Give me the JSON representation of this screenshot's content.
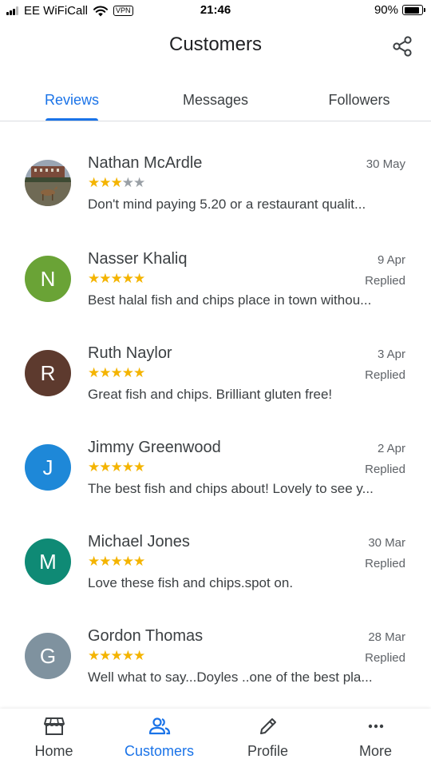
{
  "status_bar": {
    "carrier": "EE WiFiCall",
    "vpn": "VPN",
    "time": "21:46",
    "battery": "90%",
    "battery_level": 0.9
  },
  "header": {
    "title": "Customers",
    "share_icon": "share-icon"
  },
  "tabs": [
    {
      "label": "Reviews",
      "active": true
    },
    {
      "label": "Messages",
      "active": false
    },
    {
      "label": "Followers",
      "active": false
    }
  ],
  "reviews": [
    {
      "name": "Nathan McArdle",
      "date": "30 May",
      "rating": 3,
      "status": "",
      "text": "Don't mind paying 5.20 or a restaurant qualit...",
      "avatar_letter": "",
      "avatar_color": "#6b5a4a",
      "avatar_is_photo": true
    },
    {
      "name": "Nasser Khaliq",
      "date": "9 Apr",
      "rating": 5,
      "status": "Replied",
      "text": "Best halal fish and chips place in town withou...",
      "avatar_letter": "N",
      "avatar_color": "#6aa336"
    },
    {
      "name": "Ruth Naylor",
      "date": "3 Apr",
      "rating": 5,
      "status": "Replied",
      "text": "Great fish and chips. Brilliant gluten free!",
      "avatar_letter": "R",
      "avatar_color": "#5d3a2e"
    },
    {
      "name": "Jimmy Greenwood",
      "date": "2 Apr",
      "rating": 5,
      "status": "Replied",
      "text": "The best fish and chips about! Lovely to see y...",
      "avatar_letter": "J",
      "avatar_color": "#1e88d8"
    },
    {
      "name": "Michael Jones",
      "date": "30 Mar",
      "rating": 5,
      "status": "Replied",
      "text": "Love these fish and chips.spot on.",
      "avatar_letter": "M",
      "avatar_color": "#0f8a75"
    },
    {
      "name": "Gordon Thomas",
      "date": "28 Mar",
      "rating": 5,
      "status": "Replied",
      "text": "Well what to say...Doyles ..one of the best pla...",
      "avatar_letter": "G",
      "avatar_color": "#7f929f"
    }
  ],
  "bottom_nav": [
    {
      "label": "Home",
      "icon": "storefront-icon",
      "active": false
    },
    {
      "label": "Customers",
      "icon": "people-icon",
      "active": true
    },
    {
      "label": "Profile",
      "icon": "pencil-icon",
      "active": false
    },
    {
      "label": "More",
      "icon": "more-horizontal-icon",
      "active": false
    }
  ],
  "colors": {
    "accent": "#1a73e8",
    "star": "#f4b400",
    "star_empty": "#9aa0a6"
  }
}
